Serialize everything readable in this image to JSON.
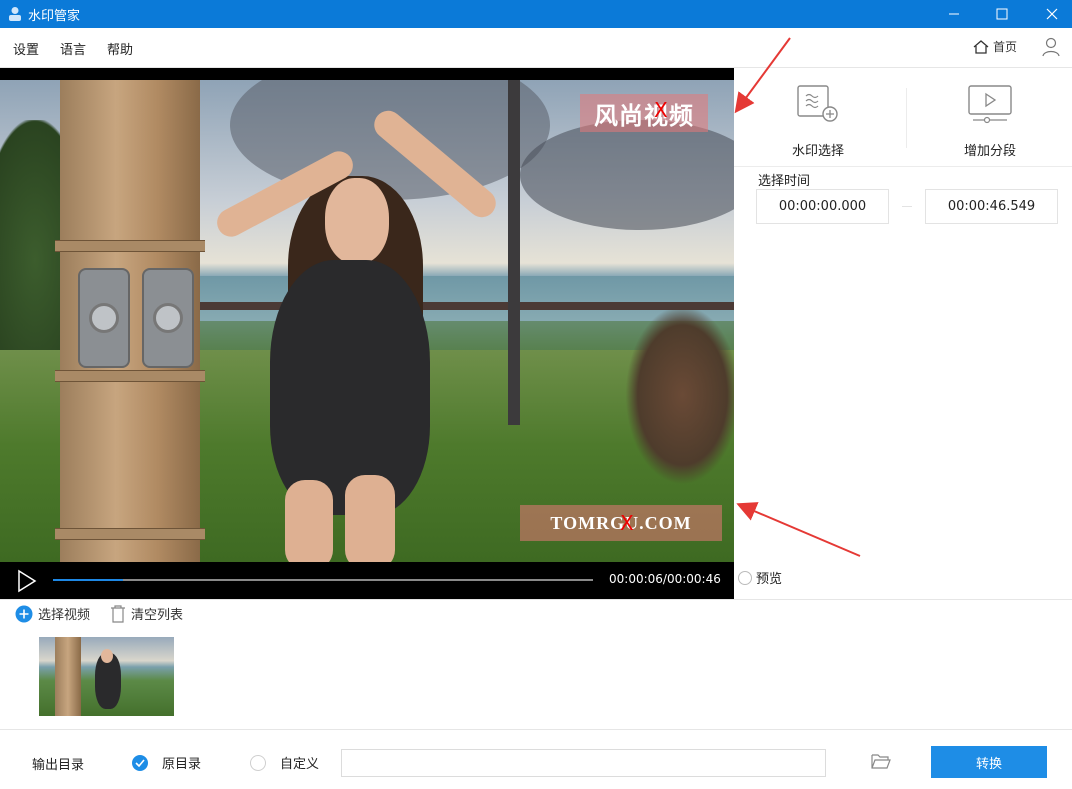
{
  "window": {
    "title": "水印管家"
  },
  "menu": {
    "items": [
      "设置",
      "语言",
      "帮助"
    ],
    "home_label": "首页"
  },
  "video": {
    "watermark_top": "风尚视频",
    "watermark_bottom": "TOMRGU.COM",
    "remove_mark": "X",
    "time_display": "00:00:06/00:00:46",
    "progress_fraction": 0.13
  },
  "panel": {
    "watermark_select_label": "水印选择",
    "add_segment_label": "增加分段",
    "select_time_label": "选择时间",
    "start_time": "00:00:00.000",
    "end_time": "00:00:46.549",
    "preview_label": "预览"
  },
  "list": {
    "select_video_label": "选择视频",
    "clear_list_label": "清空列表"
  },
  "output": {
    "dir_label": "输出目录",
    "original_dir_label": "原目录",
    "custom_label": "自定义",
    "path_value": "",
    "convert_label": "转换"
  },
  "colors": {
    "accent": "#1e8de6",
    "titlebar": "#0b7ad8",
    "annotation_arrow": "#e53935"
  }
}
